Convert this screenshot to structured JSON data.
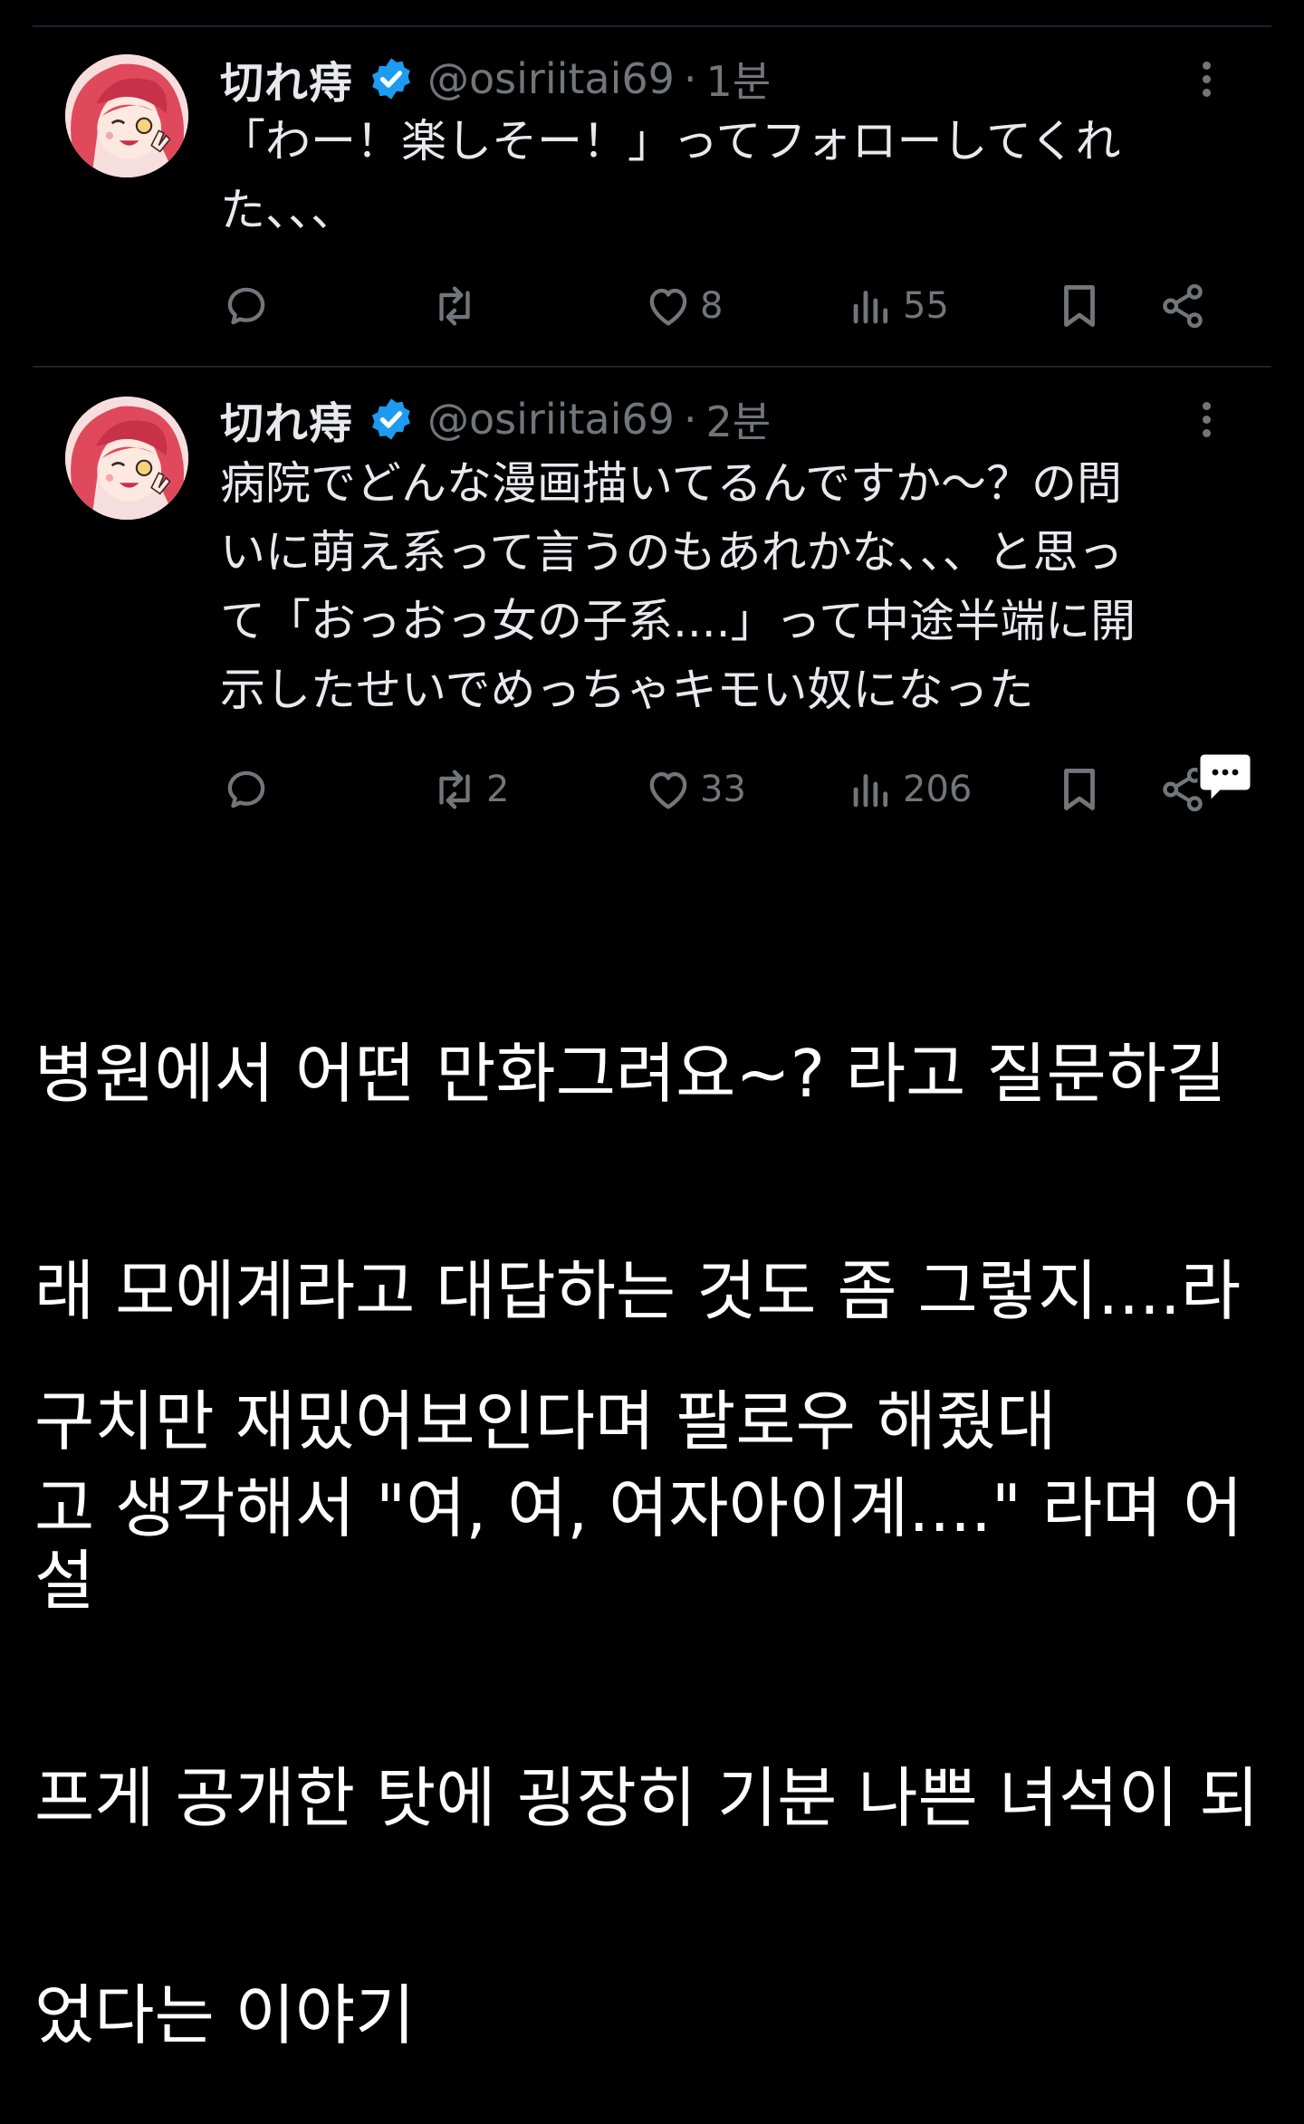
{
  "tweets": [
    {
      "name": "切れ痔",
      "handle": "@osiriitai69",
      "separator": "·",
      "time": "1분",
      "text_lines": [
        "「わー！楽しそー！」ってフォローしてくれ",
        "た、、、"
      ],
      "stats": {
        "reply": "",
        "repost": "",
        "like": "8",
        "views": "55"
      }
    },
    {
      "name": "切れ痔",
      "handle": "@osiriitai69",
      "separator": "·",
      "time": "2분",
      "text_lines": [
        "病院でどんな漫画描いてるんですか〜？の問",
        "いに萌え系って言うのもあれかな、、、と思っ",
        "て「おっおっ女の子系....」って中途半端に開",
        "示したせいでめっちゃキモい奴になった"
      ],
      "stats": {
        "reply": "",
        "repost": "2",
        "like": "33",
        "views": "206"
      }
    }
  ],
  "caption": {
    "lines": [
      "병원에서 어떤 만화그려요~? 라고 질문하길",
      "래 모에계라고 대답하는 것도 좀 그렇지....라",
      "고 생각해서 \"여, 여, 여자아이계....\" 라며 어설",
      "프게 공개한 탓에 굉장히 기분 나쁜 녀석이 되",
      "었다는 이야기"
    ],
    "footer": "구치만 재밌어보인다며 팔로우 해줬대"
  },
  "colors": {
    "background": "#000000",
    "text": "#e7e9ea",
    "muted": "#71767b",
    "verified": "#1d9bf0",
    "divider": "#1f2226"
  },
  "icons": [
    "reply-icon",
    "repost-icon",
    "like-icon",
    "views-icon",
    "bookmark-icon",
    "share-icon",
    "verified-badge-icon",
    "more-icon",
    "chat-bubble-icon"
  ]
}
